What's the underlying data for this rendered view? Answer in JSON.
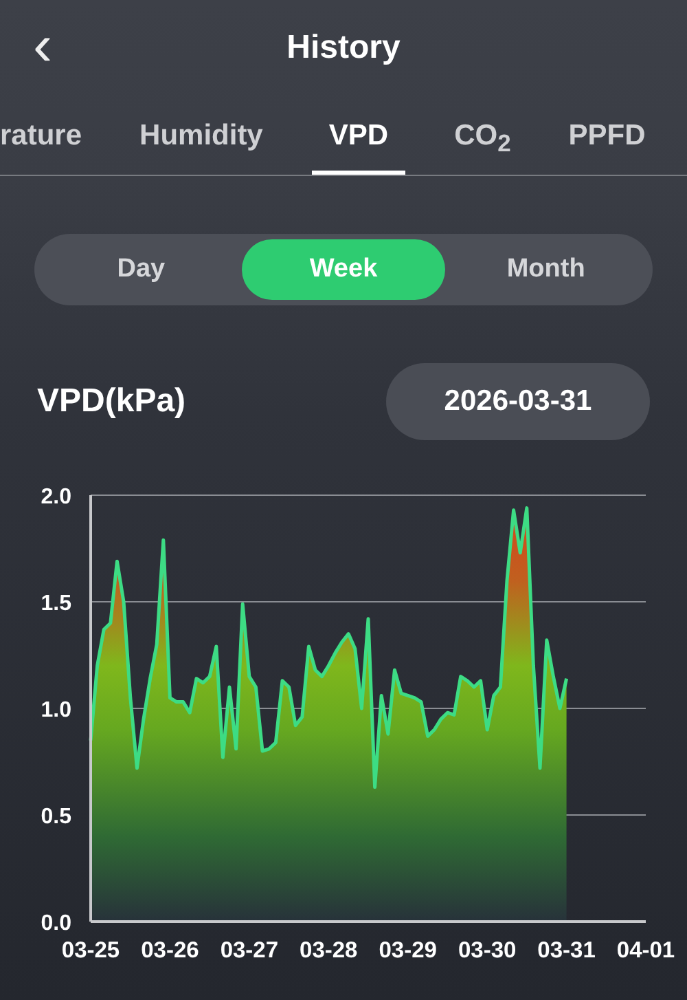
{
  "header": {
    "back": "‹",
    "title": "History"
  },
  "tabs": [
    {
      "label": "rature",
      "selected": false
    },
    {
      "label": "Humidity",
      "selected": false
    },
    {
      "label": "VPD",
      "selected": true
    },
    {
      "label": "CO$_{2}$",
      "selected": false
    },
    {
      "label": "PPFD",
      "selected": false
    }
  ],
  "periods": [
    {
      "label": "Day",
      "selected": false
    },
    {
      "label": "Week",
      "selected": true
    },
    {
      "label": "Month",
      "selected": false
    }
  ],
  "metric_title": "VPD(kPa)",
  "date_button": "2026-03-31",
  "chart_data": {
    "type": "area",
    "grid": true,
    "ylim": [
      0,
      2
    ],
    "yticks": [
      {
        "value": 0,
        "label": "0.0"
      },
      {
        "value": 0.5,
        "label": "0.5"
      },
      {
        "value": 1,
        "label": "1.0"
      },
      {
        "value": 1.5,
        "label": "1.5"
      },
      {
        "value": 2,
        "label": "2.0"
      }
    ],
    "categories": [
      "03-25",
      null,
      null,
      null,
      null,
      null,
      null,
      null,
      null,
      null,
      null,
      null,
      "03-26",
      null,
      null,
      null,
      null,
      null,
      null,
      null,
      null,
      null,
      null,
      null,
      "03-27",
      null,
      null,
      null,
      null,
      null,
      null,
      null,
      null,
      null,
      null,
      null,
      "03-28",
      null,
      null,
      null,
      null,
      null,
      null,
      null,
      null,
      null,
      null,
      null,
      "03-29",
      null,
      null,
      null,
      null,
      null,
      null,
      null,
      null,
      null,
      null,
      null,
      "03-30",
      null,
      null,
      null,
      null,
      null,
      null,
      null,
      null,
      null,
      null,
      null,
      "03-31",
      null,
      null,
      null,
      null,
      null,
      null,
      null,
      null,
      null,
      null,
      null,
      "04-01"
    ],
    "series": [
      {
        "color": "#3ddc84",
        "values": [
          0.85,
          1.2,
          1.37,
          1.4,
          1.69,
          1.5,
          1.05,
          0.72,
          0.95,
          1.14,
          1.3,
          1.79,
          1.05,
          1.03,
          1.03,
          0.98,
          1.14,
          1.12,
          1.15,
          1.29,
          0.77,
          1.1,
          0.81,
          1.49,
          1.15,
          1.1,
          0.8,
          0.81,
          0.84,
          1.13,
          1.1,
          0.92,
          0.96,
          1.29,
          1.18,
          1.15,
          1.2,
          1.26,
          1.31,
          1.35,
          1.28,
          1.0,
          1.42,
          0.63,
          1.06,
          0.88,
          1.18,
          1.07,
          1.06,
          1.05,
          1.03,
          0.87,
          0.9,
          0.95,
          0.98,
          0.97,
          1.15,
          1.13,
          1.1,
          1.13,
          0.9,
          1.06,
          1.1,
          1.6,
          1.93,
          1.73,
          1.94,
          1.2,
          0.72,
          1.32,
          1.15,
          1.0,
          1.14,
          null,
          null,
          null,
          null,
          null,
          null,
          null,
          null,
          null,
          null,
          null,
          null
        ]
      }
    ]
  }
}
